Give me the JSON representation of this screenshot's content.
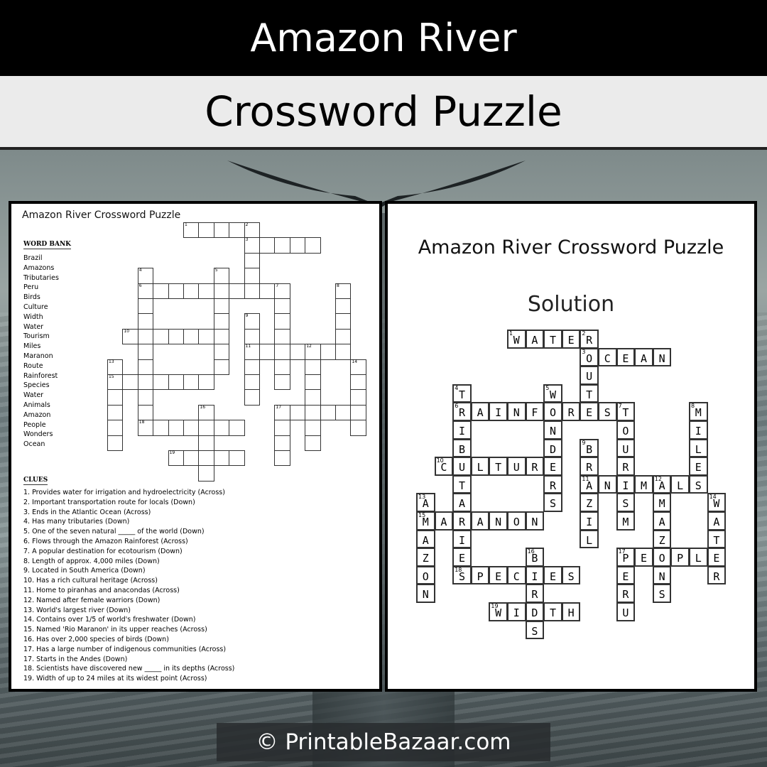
{
  "header": {
    "title": "Amazon River",
    "subtitle": "Crossword Puzzle"
  },
  "worksheet": {
    "title": "Amazon River Crossword Puzzle",
    "word_bank_heading": "WORD BANK",
    "word_bank": [
      "Brazil",
      "Amazons",
      "Tributaries",
      "Peru",
      "Birds",
      "Culture",
      "Width",
      "Water",
      "Tourism",
      "Miles",
      "Maranon",
      "Route",
      "Rainforest",
      "Species",
      "Water",
      "Animals",
      "Amazon",
      "People",
      "Wonders",
      "Ocean"
    ],
    "clues_heading": "CLUES",
    "clues": [
      "1. Provides water for irrigation and hydroelectricity (Across)",
      "2. Important transportation route for locals (Down)",
      "3. Ends in the Atlantic Ocean (Across)",
      "4. Has many tributaries (Down)",
      "5. One of the seven natural _____ of the world (Down)",
      "6. Flows through the Amazon  Rainforest (Across)",
      "7. A popular destination for ecotourism (Down)",
      "8. Length of approx. 4,000 miles (Down)",
      "9. Located in South  America (Down)",
      "10. Has a rich cultural heritage (Across)",
      "11. Home to piranhas and anacondas (Across)",
      "12. Named after female warriors (Down)",
      "13. World's largest river (Down)",
      "14. Contains over 1/5 of world's freshwater (Down)",
      "15. Named 'Rio Maranon' in its upper reaches (Across)",
      "16. Has over 2,000 species of birds (Down)",
      "17. Has a large number  of indigenous communities (Across)",
      "17. Starts in the Andes (Down)",
      "18. Scientists have discovered new _____ in its depths (Across)",
      "19. Width of up to 24 miles at its widest point (Across)"
    ]
  },
  "solution": {
    "title": "Amazon River Crossword Puzzle",
    "subtitle": "Solution"
  },
  "puzzle": {
    "words": [
      {
        "num": 1,
        "answer": "WATER",
        "dir": "across",
        "row": 0,
        "col": 5
      },
      {
        "num": 2,
        "answer": "ROUTE",
        "dir": "down",
        "row": 0,
        "col": 9
      },
      {
        "num": 3,
        "answer": "OCEAN",
        "dir": "across",
        "row": 1,
        "col": 9
      },
      {
        "num": 4,
        "answer": "TRIBUTARIES",
        "dir": "down",
        "row": 3,
        "col": 2
      },
      {
        "num": 5,
        "answer": "WONDERS",
        "dir": "down",
        "row": 3,
        "col": 7
      },
      {
        "num": 6,
        "answer": "RAINFOREST",
        "dir": "across",
        "row": 4,
        "col": 2
      },
      {
        "num": 7,
        "answer": "TOURISM",
        "dir": "down",
        "row": 4,
        "col": 11
      },
      {
        "num": 8,
        "answer": "MILES",
        "dir": "down",
        "row": 4,
        "col": 15
      },
      {
        "num": 9,
        "answer": "BRAZIL",
        "dir": "down",
        "row": 6,
        "col": 9
      },
      {
        "num": 10,
        "answer": "CULTURE",
        "dir": "across",
        "row": 7,
        "col": 1
      },
      {
        "num": 11,
        "answer": "ANIMALS",
        "dir": "across",
        "row": 8,
        "col": 9
      },
      {
        "num": 12,
        "answer": "AMAZONS",
        "dir": "down",
        "row": 8,
        "col": 13
      },
      {
        "num": 13,
        "answer": "AMAZON",
        "dir": "down",
        "row": 9,
        "col": 0
      },
      {
        "num": 14,
        "answer": "WATER",
        "dir": "down",
        "row": 9,
        "col": 16
      },
      {
        "num": 15,
        "answer": "MARANON",
        "dir": "across",
        "row": 10,
        "col": 0
      },
      {
        "num": 16,
        "answer": "BIRDS",
        "dir": "down",
        "row": 12,
        "col": 6
      },
      {
        "num": 17,
        "answer": "PEOPLE",
        "dir": "across",
        "row": 12,
        "col": 11
      },
      {
        "num": 17,
        "answer": "PERU",
        "dir": "down",
        "row": 12,
        "col": 11
      },
      {
        "num": 18,
        "answer": "SPECIES",
        "dir": "across",
        "row": 13,
        "col": 2
      },
      {
        "num": 19,
        "answer": "WIDTH",
        "dir": "across",
        "row": 15,
        "col": 4
      }
    ]
  },
  "footer": {
    "text": "© PrintableBazaar.com"
  }
}
